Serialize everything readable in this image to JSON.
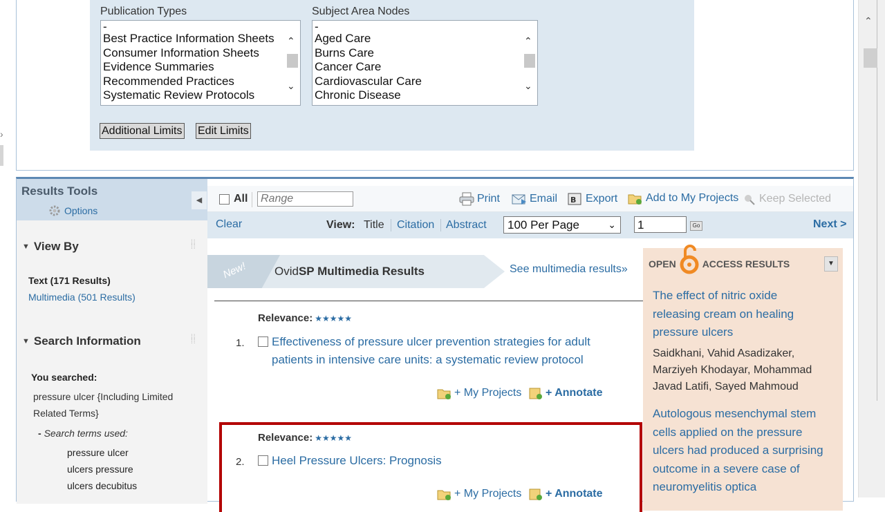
{
  "limits": {
    "publication_types_label": "Publication Types",
    "publication_types": [
      "-",
      "Best Practice Information Sheets",
      "Consumer Information Sheets",
      "Evidence Summaries",
      "Recommended Practices",
      "Systematic Review Protocols"
    ],
    "subject_area_label": "Subject Area Nodes",
    "subject_areas": [
      "-",
      "Aged Care",
      "Burns Care",
      "Cancer Care",
      "Cardiovascular Care",
      "Chronic Disease"
    ],
    "additional_limits": "Additional Limits",
    "edit_limits": "Edit Limits"
  },
  "sidebar": {
    "title": "Results Tools",
    "options": "Options",
    "view_by": "View By",
    "text_results": "Text (171 Results)",
    "multimedia_results": "Multimedia (501 Results)",
    "search_info": "Search Information",
    "you_searched": "You searched:",
    "query_line1": "pressure ulcer {Including Limited",
    "query_line2": "Related Terms}",
    "terms_used": "Search terms used:",
    "terms": [
      "pressure ulcer",
      "ulcers pressure",
      "ulcers decubitus"
    ]
  },
  "toolbar": {
    "all": "All",
    "range_placeholder": "Range",
    "print": "Print",
    "email": "Email",
    "export": "Export",
    "add_projects": "Add to My Projects",
    "keep_selected": "Keep Selected",
    "clear": "Clear",
    "view_label": "View:",
    "view_title": "Title",
    "view_citation": "Citation",
    "view_abstract": "Abstract",
    "per_page": "100 Per Page",
    "page_number": "1",
    "go": "Go",
    "next": "Next >"
  },
  "multimedia": {
    "new_badge": "New!",
    "title_prefix": "Ovid",
    "title_bold": "SP",
    "title_rest": " Multimedia Results",
    "see_link": "See multimedia results»"
  },
  "results": [
    {
      "relevance": "Relevance:",
      "stars": "★★★★★",
      "num": "1.",
      "title_line1": "Effectiveness of pressure ulcer prevention strategies for adult",
      "title_line2": "patients in intensive care units: a systematic review protocol",
      "my_projects": "+ My Projects",
      "annotate": "+  Annotate"
    },
    {
      "relevance": "Relevance:",
      "stars": "★★★★★",
      "num": "2.",
      "title_line1": "Heel Pressure Ulcers: Prognosis",
      "my_projects": "+ My Projects",
      "annotate": "+  Annotate"
    }
  ],
  "open_access": {
    "head_left": "OPEN",
    "head_right": "ACCESS RESULTS",
    "items": [
      {
        "title": [
          "The effect of nitric oxide",
          "releasing cream on healing",
          "pressure ulcers"
        ],
        "authors": [
          "Saidkhani, Vahid Asadizaker,",
          "Marziyeh Khodayar, Mohammad",
          "Javad Latifi, Sayed Mahmoud"
        ]
      },
      {
        "title": [
          "Autologous mesenchymal stem",
          "cells applied on the pressure",
          "ulcers had produced a surprising",
          "outcome in a severe case of",
          "neuromyelitis optica"
        ]
      }
    ]
  },
  "colors": {
    "link": "#2b6ca3",
    "highlight_border": "#b30000",
    "panel_blue": "#dde8f1",
    "oa_background": "#f6e2d3",
    "oa_orange": "#f08a24"
  }
}
